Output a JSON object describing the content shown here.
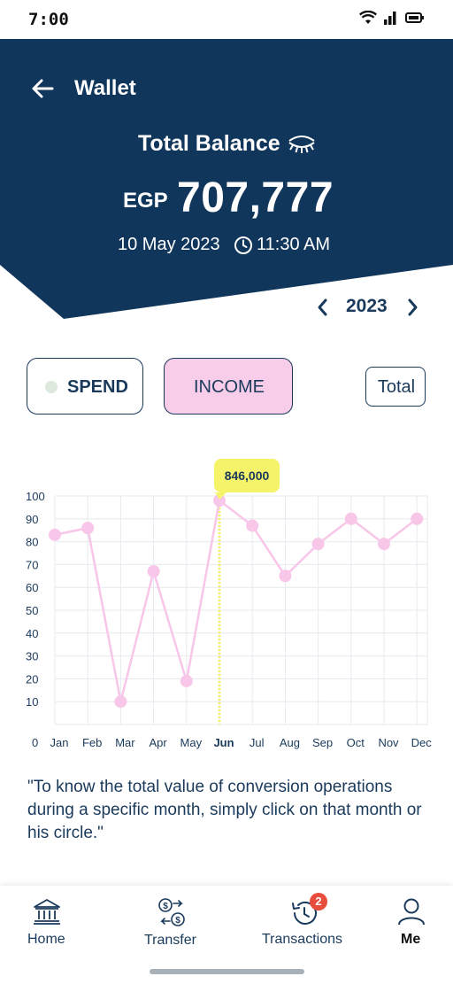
{
  "status_bar": {
    "time": "7:00"
  },
  "header": {
    "title": "Wallet",
    "balance_label": "Total Balance",
    "currency": "EGP",
    "amount": "707,777",
    "date": "10 May 2023",
    "time": "11:30 AM",
    "bg_color": "#11365b"
  },
  "year_selector": {
    "year": "2023"
  },
  "toggles": {
    "spend_label": "SPEND",
    "income_label": "INCOME",
    "total_label": "Total",
    "selected": "INCOME"
  },
  "chart_data": {
    "type": "line",
    "categories": [
      "Jan",
      "Feb",
      "Mar",
      "Apr",
      "May",
      "Jun",
      "Jul",
      "Aug",
      "Sep",
      "Oct",
      "Nov",
      "Dec"
    ],
    "values": [
      83,
      86,
      10,
      67,
      19,
      98,
      87,
      65,
      79,
      90,
      79,
      90
    ],
    "y_ticks": [
      "0",
      "10",
      "20",
      "30",
      "40",
      "50",
      "60",
      "70",
      "80",
      "90",
      "100"
    ],
    "ylim": [
      0,
      100
    ],
    "selected_category": "Jun",
    "tooltip": "846,000",
    "grid": true,
    "line_color": "#f7c6e8",
    "point_color": "#f7c6e8",
    "highlight_color": "#f5f36a"
  },
  "note": "\"To know the total value of conversion operations during a specific month, simply click on that month or his circle.\"",
  "bottom_nav": {
    "items": [
      {
        "label": "Home",
        "icon": "bank-icon"
      },
      {
        "label": "Transfer",
        "icon": "currency-exchange-icon"
      },
      {
        "label": "Transactions",
        "icon": "history-icon",
        "badge": "2"
      },
      {
        "label": "Me",
        "icon": "user-icon",
        "active": true
      }
    ]
  }
}
